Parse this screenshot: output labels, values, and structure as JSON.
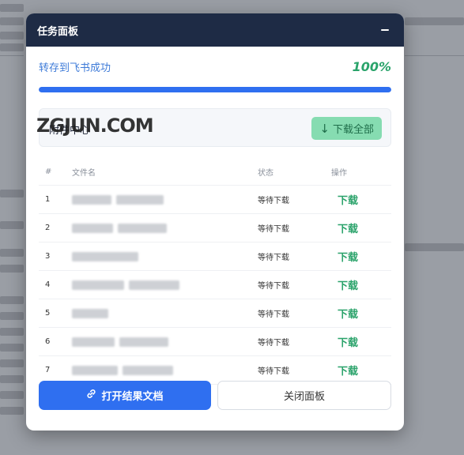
{
  "panel": {
    "title": "任务面板",
    "status_text": "转存到飞书成功",
    "progress_percent_label": "100%",
    "progress_value": 1.0
  },
  "section": {
    "title": "附件中心",
    "watermark": "ZGJUN.COM",
    "download_all_label": "下载全部",
    "download_all_icon": "↓"
  },
  "table": {
    "headers": [
      "#",
      "文件名",
      "状态",
      "操作"
    ],
    "rows": [
      {
        "num": "1",
        "status": "等待下载",
        "action": "下载"
      },
      {
        "num": "2",
        "status": "等待下载",
        "action": "下载"
      },
      {
        "num": "3",
        "status": "等待下载",
        "action": "下载"
      },
      {
        "num": "4",
        "status": "等待下载",
        "action": "下载"
      },
      {
        "num": "5",
        "status": "等待下载",
        "action": "下载"
      },
      {
        "num": "6",
        "status": "等待下载",
        "action": "下载"
      },
      {
        "num": "7",
        "status": "等待下载",
        "action": "下载"
      }
    ]
  },
  "footer": {
    "open_doc_label": "打开结果文档",
    "close_panel_label": "关闭面板"
  },
  "colors": {
    "header_bg": "#1e2b45",
    "accent_blue": "#2f6ff0",
    "success_green": "#29a36a",
    "download_all_bg": "#86dcb1"
  }
}
